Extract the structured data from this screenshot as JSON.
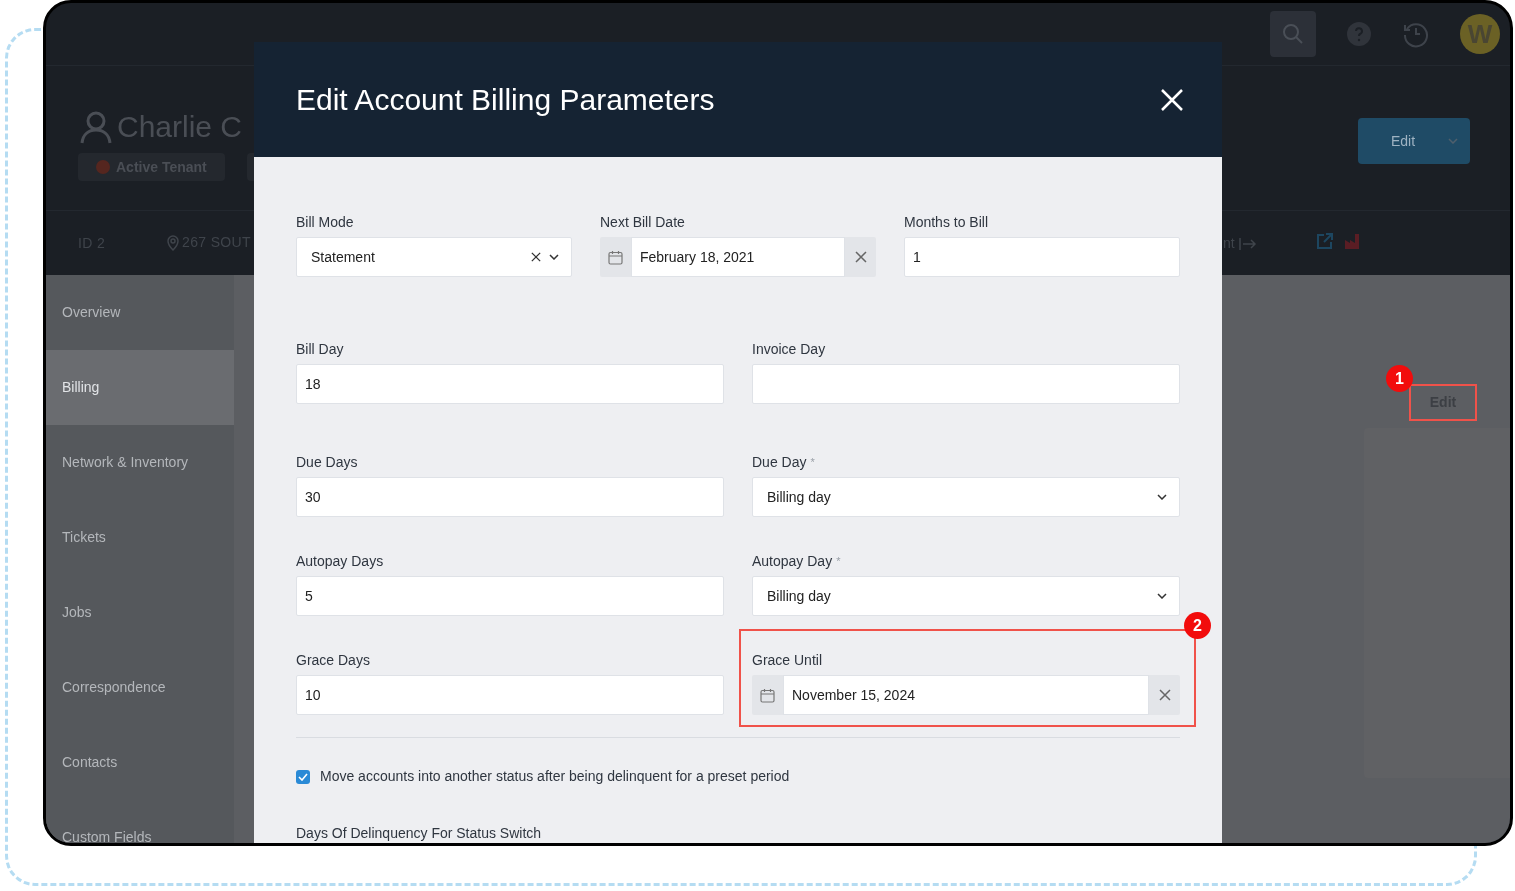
{
  "topbar": {
    "avatar": "W"
  },
  "header": {
    "name": "Charlie C",
    "status_badge": "Active Tenant",
    "edit_button": "Edit"
  },
  "info_row": {
    "id": "ID 2",
    "address": "267 SOUT",
    "right_text": "nt"
  },
  "sidebar": {
    "items": [
      {
        "label": "Overview",
        "selected": false
      },
      {
        "label": "Billing",
        "selected": true
      },
      {
        "label": "Network & Inventory",
        "selected": false
      },
      {
        "label": "Tickets",
        "selected": false
      },
      {
        "label": "Jobs",
        "selected": false
      },
      {
        "label": "Correspondence",
        "selected": false
      },
      {
        "label": "Contacts",
        "selected": false
      },
      {
        "label": "Custom Fields",
        "selected": false
      }
    ]
  },
  "main": {
    "edit_button": {
      "label": "Edit",
      "annotation": "1"
    }
  },
  "modal": {
    "title": "Edit Account Billing Parameters",
    "rows": [
      [
        {
          "kind": "select",
          "label": "Bill Mode",
          "value": "Statement",
          "clearable": true
        },
        {
          "kind": "date",
          "label": "Next Bill Date",
          "value": "February 18, 2021"
        },
        {
          "kind": "text",
          "label": "Months to Bill",
          "value": "1"
        }
      ],
      [
        {
          "kind": "text",
          "label": "Bill Day",
          "value": "18"
        },
        {
          "kind": "text",
          "label": "Invoice Day"
        }
      ],
      [
        {
          "kind": "text",
          "label": "Due Days",
          "value": "30"
        },
        {
          "kind": "select",
          "label": "Due Day",
          "required_mark": "*",
          "value": "Billing day",
          "clearable": false
        }
      ],
      [
        {
          "kind": "text",
          "label": "Autopay Days",
          "value": "5"
        },
        {
          "kind": "select",
          "label": "Autopay Day",
          "required_mark": "*",
          "value": "Billing day",
          "clearable": false
        }
      ],
      [
        {
          "kind": "text",
          "label": "Grace Days",
          "value": "10"
        },
        {
          "kind": "date",
          "label": "Grace Until",
          "value": "November 15, 2024",
          "annotation": "2"
        }
      ]
    ],
    "checkbox": {
      "label": "Move accounts into another status after being delinquent for a preset period",
      "checked": true
    },
    "next_label": "Days Of Delinquency For Status Switch"
  }
}
